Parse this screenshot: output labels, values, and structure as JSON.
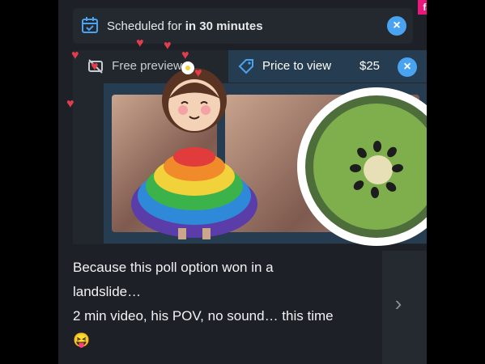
{
  "watermark": "fapellino.net",
  "schedule": {
    "prefix": "Scheduled for",
    "value": "in 30 minutes"
  },
  "tabs": {
    "free_label": "Free preview",
    "price_label": "Price to view",
    "price_value": "$25"
  },
  "post": {
    "line1": "Because this poll option won in a",
    "line2": "landslide…",
    "line3": "2 min video, his POV, no sound… this time",
    "emoji": "😝"
  },
  "icons": {
    "calendar": "calendar-check-icon",
    "close": "close-icon",
    "no-image": "image-off-icon",
    "price-tag": "price-tag-icon",
    "chevron": "chevron-right-icon"
  },
  "colors": {
    "accent": "#4aa3f0",
    "panel_highlight": "#263c50",
    "background": "#1d2127"
  }
}
